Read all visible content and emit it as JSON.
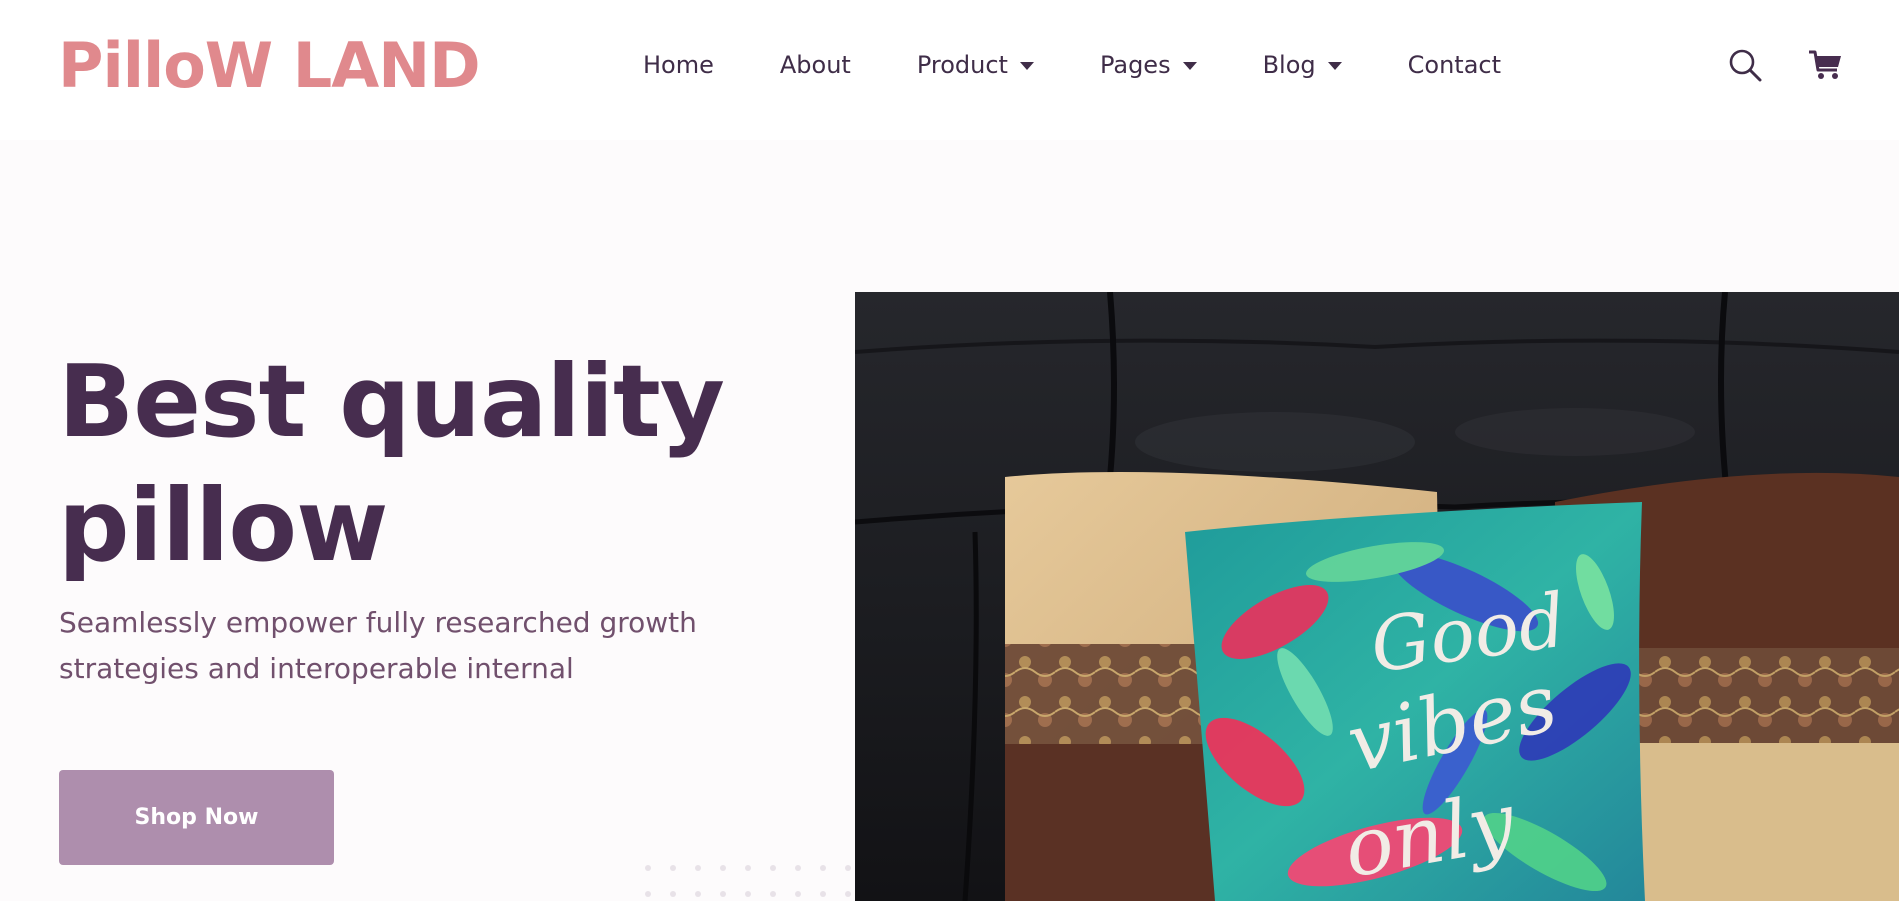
{
  "brand": {
    "logo": "PilloW LAND",
    "color": "#e0898d"
  },
  "nav": {
    "items": [
      {
        "label": "Home",
        "dropdown": false
      },
      {
        "label": "About",
        "dropdown": false
      },
      {
        "label": "Product",
        "dropdown": true
      },
      {
        "label": "Pages",
        "dropdown": true
      },
      {
        "label": "Blog",
        "dropdown": true
      },
      {
        "label": "Contact",
        "dropdown": false
      }
    ]
  },
  "header_icons": {
    "search": "search-icon",
    "cart": "cart-icon"
  },
  "hero": {
    "title_line1": "Best quality",
    "title_line2": "pillow",
    "subtitle_line1": "Seamlessly empower fully researched growth",
    "subtitle_line2": "strategies and interoperable internal",
    "cta_label": "Shop Now",
    "pillow_text": [
      "Good",
      "vibes",
      "only"
    ]
  },
  "colors": {
    "heading": "#472d4f",
    "nav_text": "#3f2d48",
    "subtitle": "#71506d",
    "button": "#ae8ead"
  }
}
